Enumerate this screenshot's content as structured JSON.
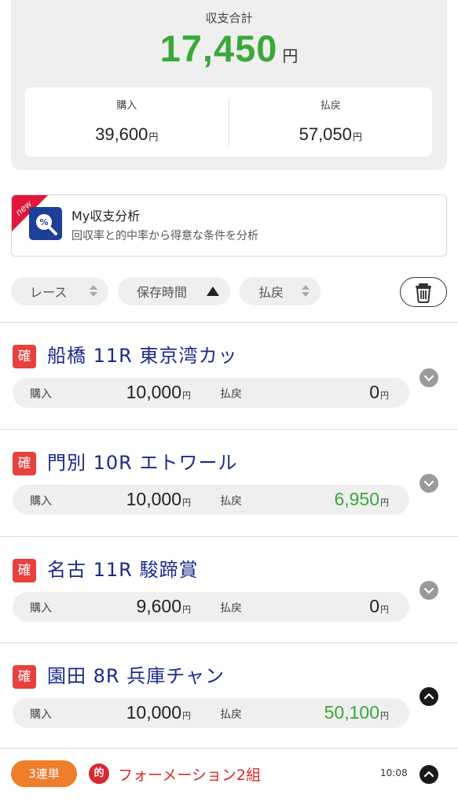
{
  "summary": {
    "label": "収支合計",
    "total": "17,450",
    "unit": "円",
    "purchase_label": "購入",
    "purchase_value": "39,600",
    "payout_label": "払戻",
    "payout_value": "57,050",
    "yen": "円",
    "total_color": "#3aa83a"
  },
  "banner": {
    "ribbon": "new",
    "title": "My収支分析",
    "description": "回収率と的中率から得意な条件を分析",
    "icon": "percent-magnifier-icon"
  },
  "sort": {
    "race": "レース",
    "time": "保存時間",
    "payout": "払戻",
    "active": "time",
    "direction": "ascending"
  },
  "races": [
    {
      "badge": "確",
      "title": "船橋 11R 東京湾カッ",
      "purchase_label": "購入",
      "purchase": "10,000",
      "payout_label": "払戻",
      "payout": "0",
      "yen": "円",
      "win": false,
      "expanded": false
    },
    {
      "badge": "確",
      "title": "門別 10R エトワール",
      "purchase_label": "購入",
      "purchase": "10,000",
      "payout_label": "払戻",
      "payout": "6,950",
      "yen": "円",
      "win": true,
      "expanded": false
    },
    {
      "badge": "確",
      "title": "名古 11R 駿蹄賞",
      "purchase_label": "購入",
      "purchase": "9,600",
      "payout_label": "払戻",
      "payout": "0",
      "yen": "円",
      "win": false,
      "expanded": false
    },
    {
      "badge": "確",
      "title": "園田 8R 兵庫チャン",
      "purchase_label": "購入",
      "purchase": "10,000",
      "payout_label": "払戻",
      "payout": "50,100",
      "yen": "円",
      "win": true,
      "expanded": true
    }
  ],
  "bet": {
    "type": "3連単",
    "hit_badge": "的",
    "description": "フォーメーション2組",
    "time": "10:08"
  },
  "colors": {
    "accent_green": "#3aa83a",
    "title_navy": "#1a2a8e",
    "badge_red": "#e8413d",
    "bet_orange": "#ee7d2c"
  }
}
